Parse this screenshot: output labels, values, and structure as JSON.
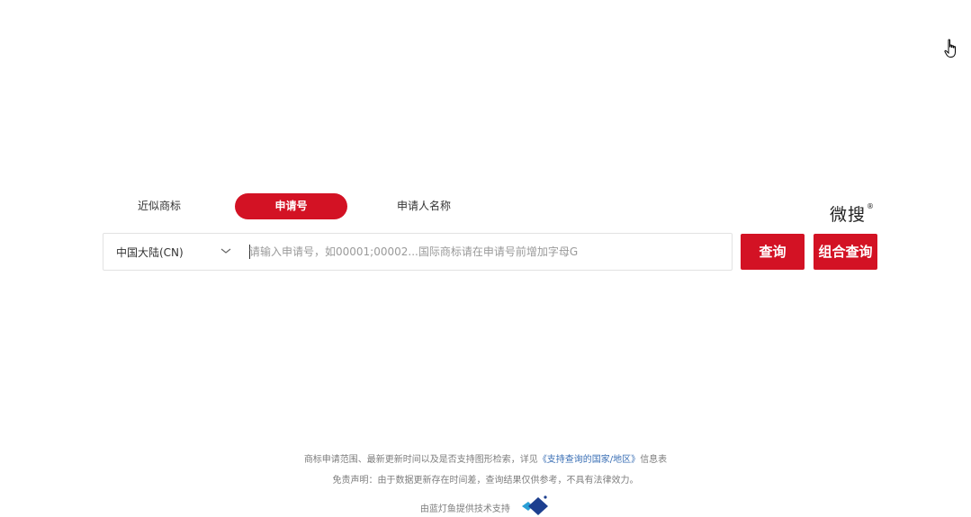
{
  "tabs": [
    {
      "label": "近似商标",
      "active": false
    },
    {
      "label": "申请号",
      "active": true
    },
    {
      "label": "申请人名称",
      "active": false
    }
  ],
  "brand": {
    "name": "微搜",
    "mark": "®"
  },
  "search": {
    "region_value": "中国大陆(CN)",
    "placeholder": "请输入申请号，如00001;00002...国际商标请在申请号前增加字母G",
    "value": ""
  },
  "buttons": {
    "query": "查询",
    "combined_query": "组合查询"
  },
  "footer": {
    "line1_prefix": "商标申请范围、最新更新时间以及是否支持图形检索，详见",
    "line1_link": "《支持查询的国家/地区》",
    "line1_suffix": "信息表",
    "disclaimer": "免责声明：由于数据更新存在时间差，查询结果仅供参考，不具有法律效力。",
    "powered_by": "由蓝灯鱼提供技术支持"
  },
  "colors": {
    "accent": "#d31224",
    "link": "#3a6fb5",
    "logo_primary": "#1d3f8f",
    "logo_secondary": "#2a9fd6"
  },
  "icons": {
    "cursor": "hand-pointer-icon",
    "region_toggle": "chevron-down-icon",
    "logo": "lanengyu-logo-icon"
  }
}
